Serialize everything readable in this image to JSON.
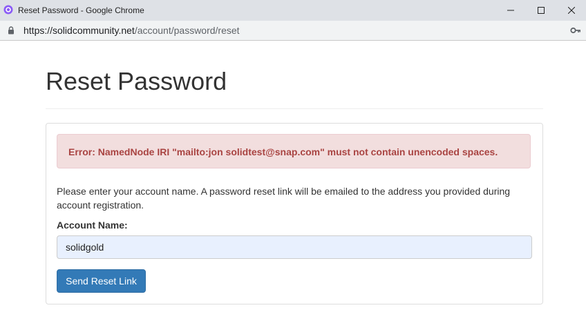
{
  "window": {
    "title": "Reset Password - Google Chrome"
  },
  "addressbar": {
    "url_scheme_host": "https://solidcommunity.net",
    "url_path": "/account/password/reset"
  },
  "icons": {
    "app": "chrome-profile-icon",
    "lock": "lock-icon",
    "key": "key-icon",
    "minimize": "minimize-icon",
    "maximize": "maximize-icon",
    "close": "close-icon"
  },
  "page": {
    "title": "Reset Password",
    "error": "Error: NamedNode IRI \"mailto:jon solidtest@snap.com\" must not contain unencoded spaces.",
    "help_text": "Please enter your account name. A password reset link will be emailed to the address you provided during account registration.",
    "account_label": "Account Name:",
    "account_value": "solidgold",
    "submit_label": "Send Reset Link"
  },
  "colors": {
    "primary_button": "#337ab7",
    "alert_bg": "#f2dede",
    "alert_text": "#a94442",
    "autofill_bg": "#e8f0fe"
  }
}
